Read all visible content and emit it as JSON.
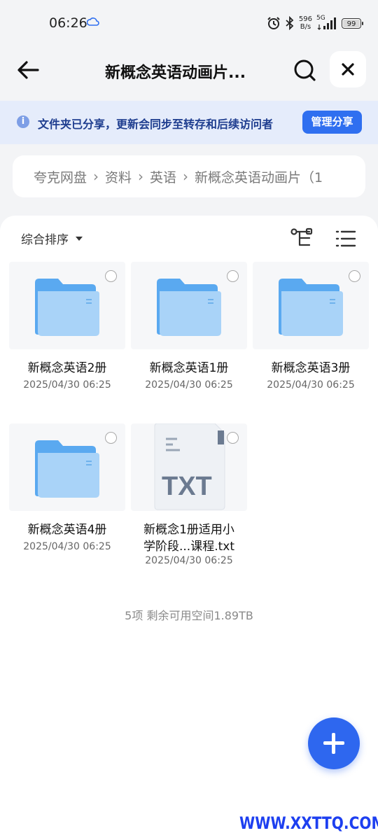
{
  "status_bar": {
    "time": "06:26",
    "net_speed_value": "596",
    "net_speed_unit": "B/s",
    "signal_label": "5G",
    "battery": "99",
    "battery_level": 0.99
  },
  "header": {
    "title": "新概念英语动画片...",
    "back_icon": "arrow-left-icon",
    "search_icon": "search-icon",
    "close_icon": "close-icon"
  },
  "share_banner": {
    "text": "文件夹已分享，更新会同步至转存和后续访问者",
    "button_label": "管理分享",
    "button_color": "#2f6ff0"
  },
  "breadcrumb": {
    "items": [
      "夸克网盘",
      "资料",
      "英语",
      "新概念英语动画片（1"
    ]
  },
  "toolbar": {
    "sort_label": "综合排序"
  },
  "files": [
    {
      "name": "新概念英语2册",
      "date": "2025/04/30 06:25",
      "type": "folder"
    },
    {
      "name": "新概念英语1册",
      "date": "2025/04/30 06:25",
      "type": "folder"
    },
    {
      "name": "新概念英语3册",
      "date": "2025/04/30 06:25",
      "type": "folder"
    },
    {
      "name": "新概念英语4册",
      "date": "2025/04/30 06:25",
      "type": "folder"
    },
    {
      "name_line1": "新概念1册适用小",
      "name_line2": "学阶段...课程.txt",
      "date": "2025/04/30 06:25",
      "type": "txt",
      "type_label": "TXT"
    }
  ],
  "footer": {
    "info": "5项 剩余可用空间1.89TB"
  },
  "watermark": "WWW.XXTTQ.COM",
  "colors": {
    "accent": "#2f6ff0",
    "banner_bg": "#e5ecfb",
    "folder": "#5aa9f0"
  }
}
